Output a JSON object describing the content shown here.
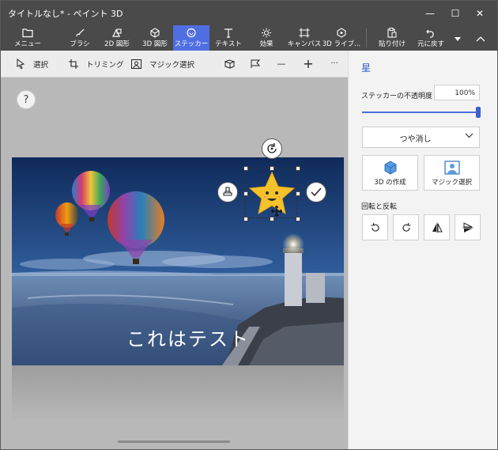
{
  "window": {
    "title": "タイトルなし* - ペイント 3D",
    "minimize_glyph": "—",
    "maximize_glyph": "☐",
    "close_glyph": "✕"
  },
  "ribbon": {
    "items": [
      {
        "label": "メニュー",
        "icon": "folder-icon"
      },
      {
        "label": "ブラシ",
        "icon": "brush-icon"
      },
      {
        "label": "2D 図形",
        "icon": "shapes-2d-icon"
      },
      {
        "label": "3D 図形",
        "icon": "cube-icon"
      },
      {
        "label": "ステッカー",
        "icon": "sticker-icon",
        "active": true
      },
      {
        "label": "テキスト",
        "icon": "text-icon"
      },
      {
        "label": "効果",
        "icon": "sun-icon"
      },
      {
        "label": "キャンバス",
        "icon": "canvas-icon"
      },
      {
        "label": "3D ライブ...",
        "icon": "library-icon"
      },
      {
        "label": "貼り付け",
        "icon": "paste-icon"
      },
      {
        "label": "元に戻す",
        "icon": "undo-icon"
      }
    ],
    "accent": "#4f6ee2"
  },
  "toolbar": {
    "select_label": "選択",
    "crop_label": "トリミング",
    "magic_select_label": "マジック選択",
    "minus_glyph": "—",
    "plus_glyph": "+",
    "more_glyph": "···"
  },
  "canvas": {
    "help_glyph": "?",
    "text": "これはテスト"
  },
  "panel": {
    "title": "星",
    "opacity_label": "ステッカーの不透明度",
    "opacity_value": "100%",
    "opacity_fraction": 1.0,
    "finish_value": "つや消し",
    "make_3d_label": "3D の作成",
    "magic_select_label": "マジック選択",
    "rotate_flip_label": "回転と反転",
    "accent": "#2f5fc7"
  }
}
